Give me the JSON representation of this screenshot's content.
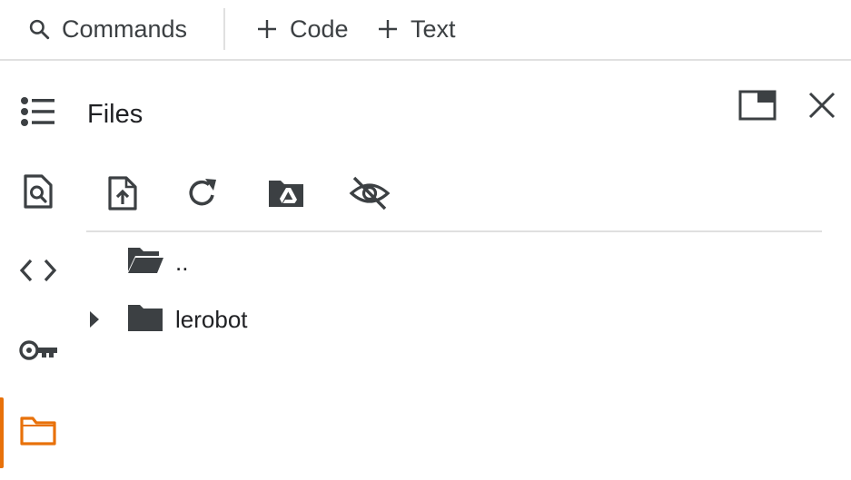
{
  "toolbar": {
    "commands_label": "Commands",
    "code_label": "Code",
    "text_label": "Text"
  },
  "rail": {
    "items": [
      {
        "name": "table-of-contents",
        "icon": "list-bulleted-icon"
      },
      {
        "name": "find-and-replace",
        "icon": "find-in-page-icon"
      },
      {
        "name": "code-snippets",
        "icon": "code-brackets-icon"
      },
      {
        "name": "secrets",
        "icon": "key-icon"
      },
      {
        "name": "files",
        "icon": "folder-outline-icon",
        "active": true
      }
    ],
    "active_color": "#e8710a"
  },
  "files_panel": {
    "title": "Files",
    "tools": [
      {
        "name": "upload-file",
        "icon": "file-upload-icon"
      },
      {
        "name": "refresh",
        "icon": "refresh-icon"
      },
      {
        "name": "mount-drive",
        "icon": "drive-folder-icon"
      },
      {
        "name": "toggle-hidden-files",
        "icon": "eye-off-icon"
      }
    ],
    "tree": [
      {
        "label": "..",
        "icon": "folder-open-icon",
        "expandable": false
      },
      {
        "label": "lerobot",
        "icon": "folder-icon",
        "expandable": true
      }
    ]
  }
}
